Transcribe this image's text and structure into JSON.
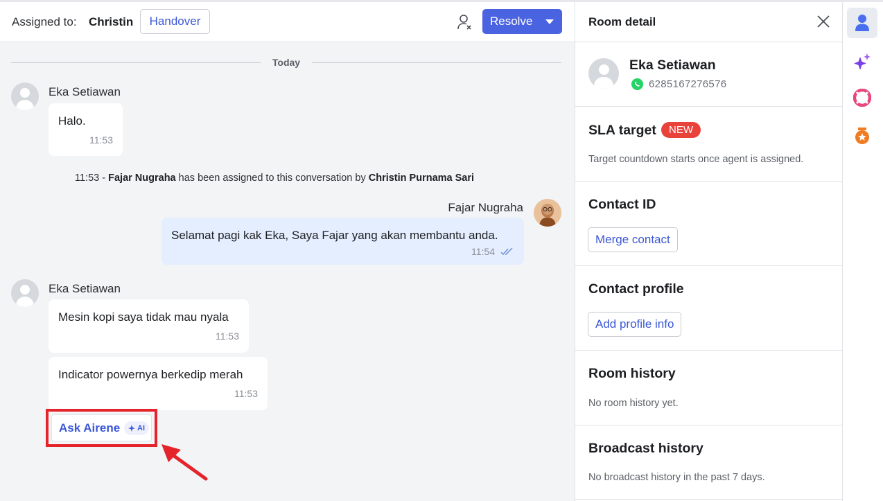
{
  "chat_header": {
    "assigned_label": "Assigned to:",
    "assigned_name": "Christin",
    "handover_label": "Handover",
    "resolve_label": "Resolve"
  },
  "divider": {
    "label": "Today"
  },
  "messages": [
    {
      "sender": "Eka Setiawan",
      "text": "Halo.",
      "time": "11:53"
    },
    {
      "text": "Mesin kopi saya tidak mau nyala",
      "time": "11:53"
    },
    {
      "text": "Indicator powernya berkedip merah",
      "time": "11:53"
    }
  ],
  "second_sender": "Eka Setiawan",
  "system": {
    "time": "11:53",
    "sep": "-",
    "agent": "Fajar Nugraha",
    "middle": "has been assigned to this conversation by",
    "by": "Christin Purnama Sari"
  },
  "outgoing": {
    "sender": "Fajar Nugraha",
    "text": "Selamat pagi kak Eka, Saya Fajar yang akan membantu anda.",
    "time": "11:54"
  },
  "ask_airene": {
    "label": "Ask Airene",
    "badge": "AI"
  },
  "room_detail": {
    "title": "Room detail",
    "contact_name": "Eka Setiawan",
    "contact_phone": "6285167276576",
    "sla_title": "SLA target",
    "sla_badge": "NEW",
    "sla_note": "Target countdown starts once agent is assigned.",
    "contact_id_title": "Contact ID",
    "merge_label": "Merge contact",
    "profile_title": "Contact profile",
    "add_profile_label": "Add profile info",
    "room_history_title": "Room history",
    "room_history_note": "No room history yet.",
    "broadcast_title": "Broadcast history",
    "broadcast_note": "No broadcast history in the past 7 days."
  },
  "icons": {
    "user_tab": "user-icon",
    "ai_tab": "sparkle-icon",
    "help_tab": "lifebuoy-icon",
    "badge_tab": "badge-icon"
  },
  "colors": {
    "primary": "#4a63e0",
    "link": "#3b57d6",
    "outgoing_bubble": "#e4eefe",
    "highlight": "#e5232b",
    "new_badge": "#e8423a"
  }
}
